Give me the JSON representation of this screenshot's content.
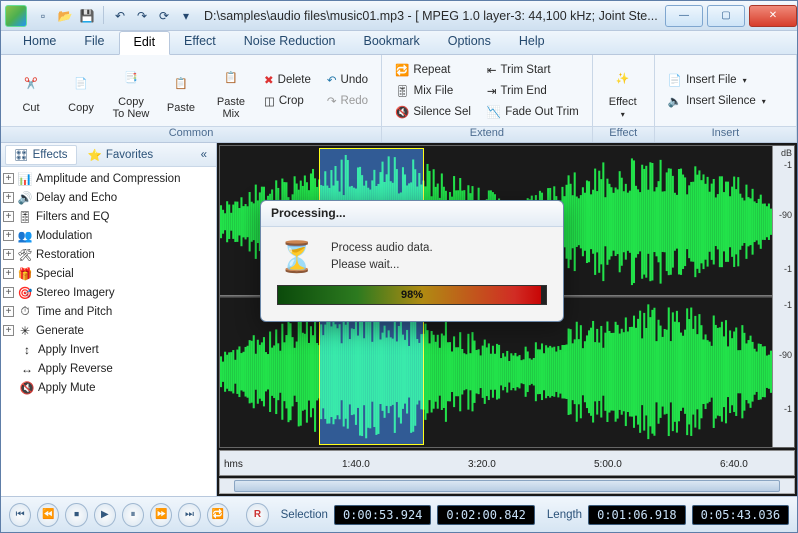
{
  "titlebar": {
    "title": "D:\\samples\\audio files\\music01.mp3 - [ MPEG 1.0 layer-3: 44,100 kHz; Joint Ste..."
  },
  "menu": {
    "items": [
      "Home",
      "File",
      "Edit",
      "Effect",
      "Noise Reduction",
      "Bookmark",
      "Options",
      "Help"
    ],
    "active_index": 2
  },
  "ribbon": {
    "common": {
      "label": "Common",
      "cut": "Cut",
      "copy": "Copy",
      "copy_to_new": "Copy\nTo New",
      "paste": "Paste",
      "paste_mix": "Paste\nMix",
      "delete": "Delete",
      "crop": "Crop",
      "undo": "Undo",
      "redo": "Redo"
    },
    "extend": {
      "label": "Extend",
      "repeat": "Repeat",
      "mix_file": "Mix File",
      "silence_sel": "Silence Sel",
      "trim_start": "Trim Start",
      "trim_end": "Trim End",
      "fade_out_trim": "Fade Out Trim"
    },
    "effect": {
      "label": "Effect",
      "effect": "Effect"
    },
    "insert": {
      "label": "Insert",
      "insert_file": "Insert File",
      "insert_silence": "Insert Silence"
    }
  },
  "sidebar": {
    "tab_effects": "Effects",
    "tab_favorites": "Favorites",
    "items": [
      {
        "label": "Amplitude and Compression",
        "exp": true
      },
      {
        "label": "Delay and Echo",
        "exp": true
      },
      {
        "label": "Filters and EQ",
        "exp": true
      },
      {
        "label": "Modulation",
        "exp": true
      },
      {
        "label": "Restoration",
        "exp": true
      },
      {
        "label": "Special",
        "exp": true
      },
      {
        "label": "Stereo Imagery",
        "exp": true
      },
      {
        "label": "Time and Pitch",
        "exp": true
      },
      {
        "label": "Generate",
        "exp": true
      },
      {
        "label": "Apply Invert",
        "exp": false
      },
      {
        "label": "Apply Reverse",
        "exp": false
      },
      {
        "label": "Apply Mute",
        "exp": false
      }
    ]
  },
  "editor": {
    "db_unit": "dB",
    "db_marks": [
      "-1",
      "",
      "-90",
      "",
      "-1"
    ],
    "ruler_unit": "hms",
    "ruler_ticks": [
      "1:40.0",
      "3:20.0",
      "5:00.0",
      "6:40.0"
    ],
    "selection": {
      "start_pct": 18,
      "width_pct": 19
    }
  },
  "status": {
    "selection_label": "Selection",
    "sel_start": "0:00:53.924",
    "sel_end": "0:02:00.842",
    "length_label": "Length",
    "len_a": "0:01:06.918",
    "len_b": "0:05:43.036",
    "record_label": "R"
  },
  "dialog": {
    "title": "Processing...",
    "line1": "Process audio data.",
    "line2": "Please wait...",
    "percent": 98,
    "percent_label": "98%"
  }
}
